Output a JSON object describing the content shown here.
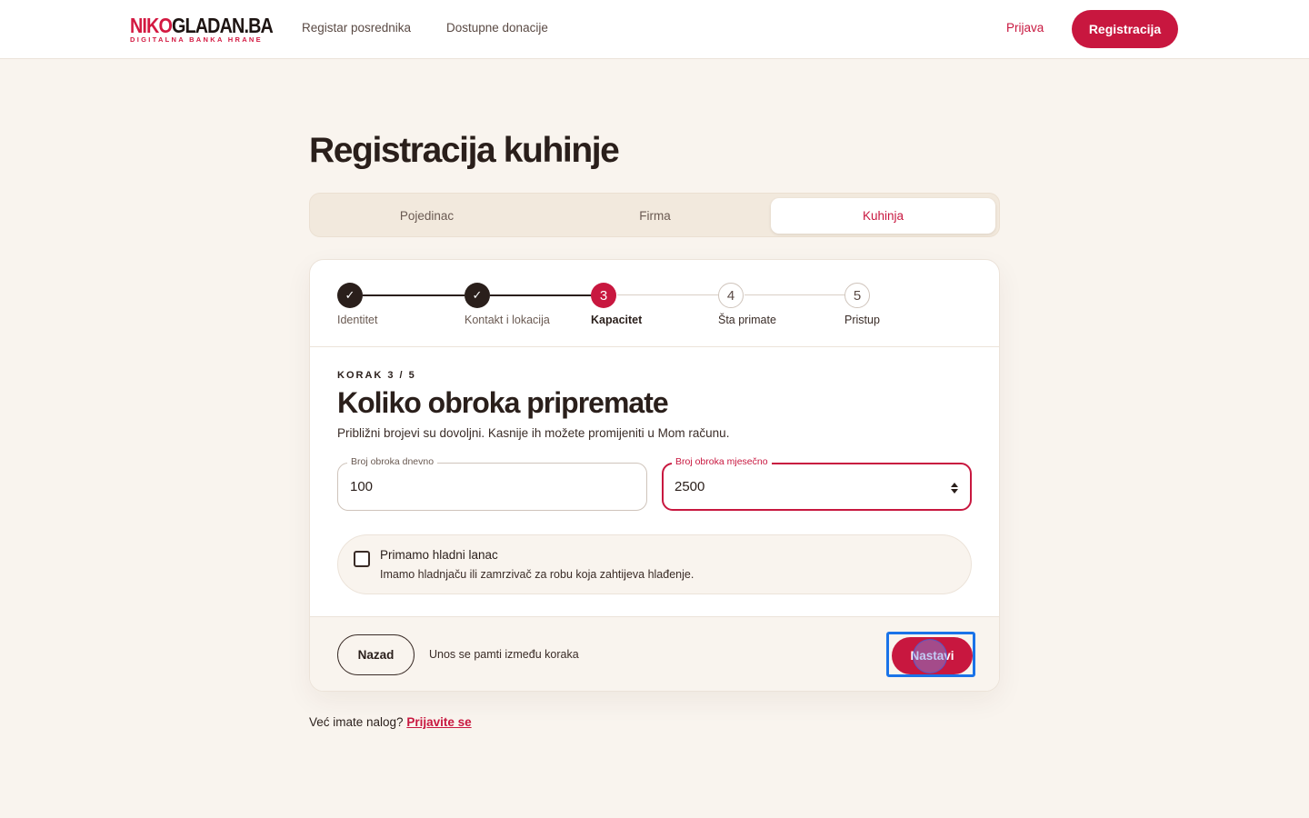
{
  "header": {
    "logo": {
      "part1": "NIKO",
      "part2": "GLADAN.BA",
      "tagline": "DIGITALNA BANKA HRANE"
    },
    "nav": [
      "Registar posrednika",
      "Dostupne donacije"
    ],
    "login_label": "Prijava",
    "register_label": "Registracija"
  },
  "page_title": "Registracija kuhinje",
  "tabs": [
    {
      "label": "Pojedinac",
      "active": false
    },
    {
      "label": "Firma",
      "active": false
    },
    {
      "label": "Kuhinja",
      "active": true
    }
  ],
  "stepper": [
    {
      "label": "Identitet",
      "state": "done",
      "marker": "✓"
    },
    {
      "label": "Kontakt i lokacija",
      "state": "done",
      "marker": "✓"
    },
    {
      "label": "Kapacitet",
      "state": "current",
      "marker": "3"
    },
    {
      "label": "Šta primate",
      "state": "todo",
      "marker": "4"
    },
    {
      "label": "Pristup",
      "state": "todo",
      "marker": "5"
    }
  ],
  "step": {
    "eyebrow": "KORAK 3 / 5",
    "title": "Koliko obroka pripremate",
    "subtitle": "Približni brojevi su dovoljni. Kasnije ih možete promijeniti u Mom računu."
  },
  "fields": {
    "daily": {
      "label": "Broj obroka dnevno",
      "value": "100"
    },
    "monthly": {
      "label": "Broj obroka mjesečno",
      "value": "2500"
    }
  },
  "cold_chain": {
    "title": "Primamo hladni lanac",
    "description": "Imamo hladnjaču ili zamrzivač za robu koja zahtijeva hlađenje.",
    "checked": false
  },
  "footer": {
    "back_label": "Nazad",
    "note": "Unos se pamti između koraka",
    "next_label": "Nastavi"
  },
  "bottom": {
    "question": "Već imate nalog?",
    "link": "Prijavite se"
  },
  "colors": {
    "accent": "#c8173f",
    "background": "#f9f4ee",
    "dark": "#2a1f1b"
  }
}
